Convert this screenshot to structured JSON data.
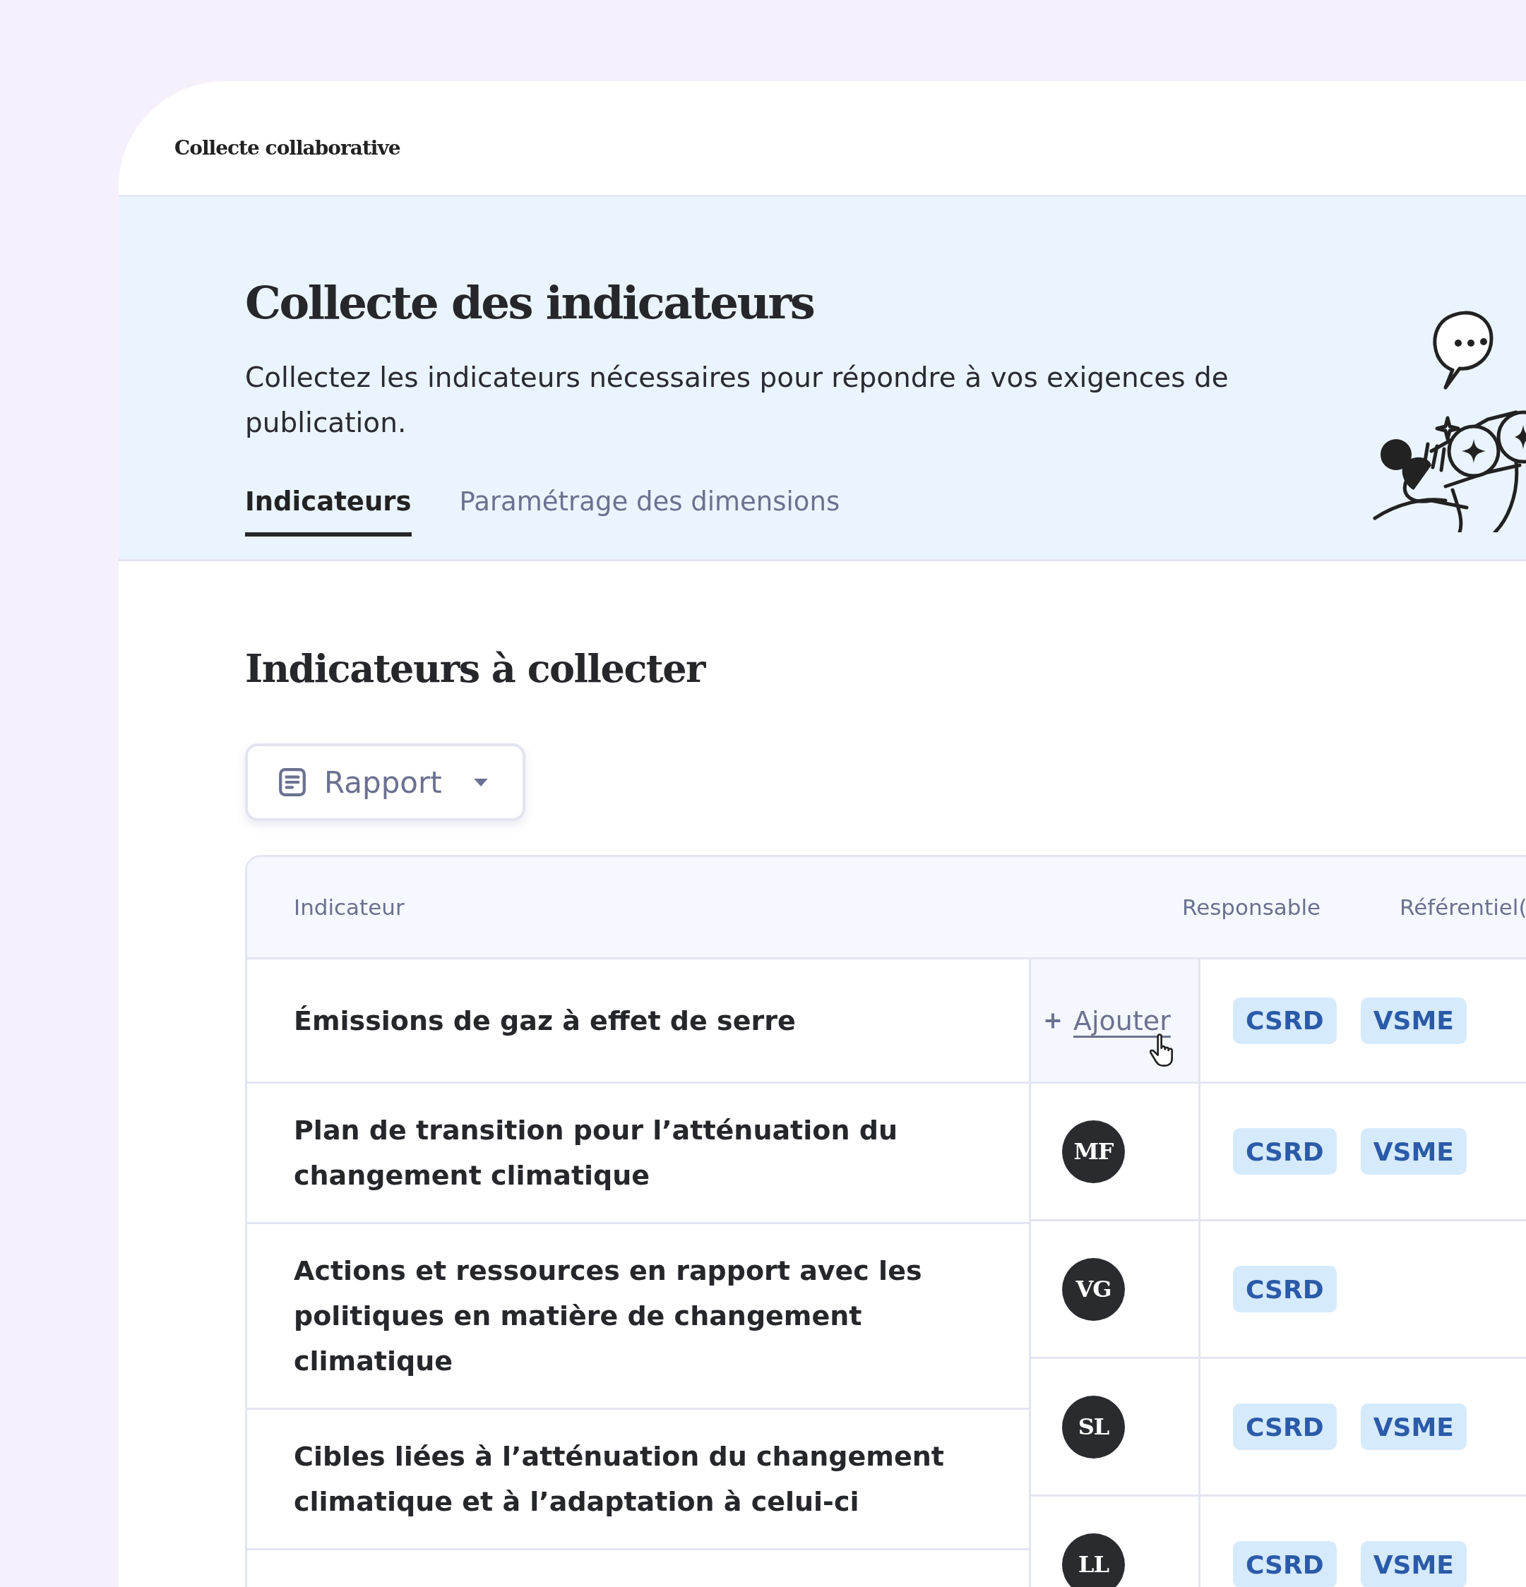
{
  "app": {
    "title": "Collecte collaborative"
  },
  "hero": {
    "title": "Collecte des indicateurs",
    "description": "Collectez les indicateurs nécessaires pour répondre à vos exigences de publication.",
    "tabs": [
      {
        "label": "Indicateurs",
        "selected": true
      },
      {
        "label": "Paramétrage des dimensions",
        "selected": false
      }
    ]
  },
  "section": {
    "title": "Indicateurs à collecter",
    "filter": {
      "value": "Rapport"
    }
  },
  "table": {
    "columns": [
      "Indicateur",
      "Responsable",
      "Référentiel("
    ],
    "indicators": [
      "Émissions de gaz à effet de serre",
      "Plan de transition pour l’atténuation du changement climatique",
      "Actions et ressources en rapport avec les politiques en matière de changement climatique",
      "Cibles liées à l’atténuation du changement climatique et à l’adaptation à celui-ci"
    ],
    "assignments": [
      {
        "responsible": {
          "kind": "add",
          "label": "Ajouter",
          "hovered": true
        },
        "referentials": [
          "CSRD",
          "VSME"
        ]
      },
      {
        "responsible": {
          "kind": "avatar",
          "initials": "MF"
        },
        "referentials": [
          "CSRD",
          "VSME"
        ]
      },
      {
        "responsible": {
          "kind": "avatar",
          "initials": "VG"
        },
        "referentials": [
          "CSRD"
        ]
      },
      {
        "responsible": {
          "kind": "avatar",
          "initials": "SL"
        },
        "referentials": [
          "CSRD",
          "VSME"
        ]
      },
      {
        "responsible": {
          "kind": "avatar",
          "initials": "LL"
        },
        "referentials": [
          "CSRD",
          "VSME"
        ]
      }
    ]
  }
}
